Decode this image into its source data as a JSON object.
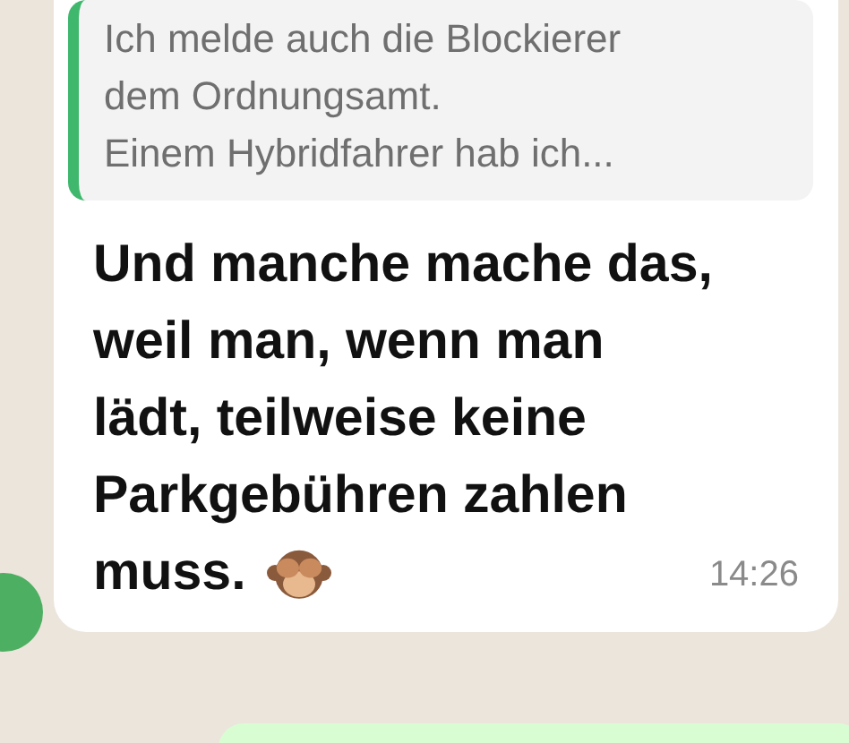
{
  "message": {
    "quote": {
      "lines": [
        "Ich melde auch die Blockierer",
        "dem Ordnungsamt.",
        "Einem Hybridfahrer hab ich..."
      ]
    },
    "lines": [
      "Und manche mache das,",
      "weil man, wenn man",
      "lädt, teilweise keine",
      "Parkgebühren zahlen",
      "muss."
    ],
    "time": "14:26"
  }
}
